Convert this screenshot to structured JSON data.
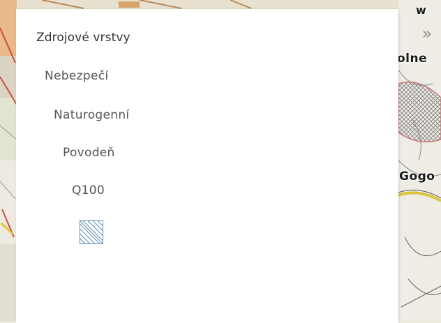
{
  "panel": {
    "title": "Zdrojové vrstvy",
    "levels": [
      "Nebezpečí",
      "Naturogenní",
      "Povodeň",
      "Q100"
    ],
    "swatch_icon": "hatched-diagonal-square",
    "swatch_color": "#5b8db3"
  },
  "collapse_button": {
    "label": "»"
  },
  "map": {
    "labels": {
      "top": "w",
      "olne": "olne",
      "gogo": "Gogo"
    }
  }
}
